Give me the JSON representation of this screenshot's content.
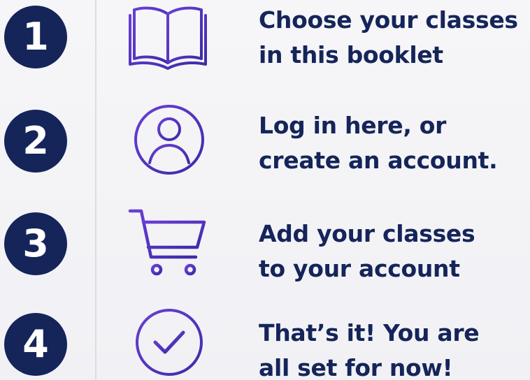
{
  "colors": {
    "circle": "#15255a",
    "text": "#15255a",
    "icon": "#5a2fc7"
  },
  "steps": [
    {
      "number": "1",
      "icon": "open-book-icon",
      "line1": "Choose your classes",
      "line2": "in this booklet"
    },
    {
      "number": "2",
      "icon": "user-account-icon",
      "line1": "Log in here, or",
      "line2": "create an account."
    },
    {
      "number": "3",
      "icon": "shopping-cart-icon",
      "line1": "Add your classes",
      "line2": "to your account"
    },
    {
      "number": "4",
      "icon": "checkmark-circle-icon",
      "line1": "That’s it! You are",
      "line2": "all set for now!"
    }
  ]
}
